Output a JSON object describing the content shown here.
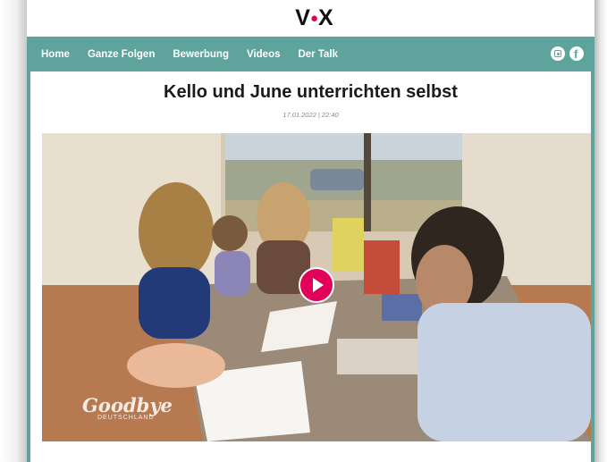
{
  "brand": {
    "logo_left": "V",
    "logo_right": "X",
    "accent": "#e2005a",
    "nav_color": "#5fa49c"
  },
  "nav": {
    "items": [
      {
        "label": "Home"
      },
      {
        "label": "Ganze Folgen"
      },
      {
        "label": "Bewerbung"
      },
      {
        "label": "Videos"
      },
      {
        "label": "Der Talk"
      }
    ],
    "icons": [
      "instagram-icon",
      "facebook-icon"
    ]
  },
  "article": {
    "title": "Kello und June unterrichten selbst",
    "date": "17.01.2022 | 22:40"
  },
  "video": {
    "watermark_title": "Goodbye",
    "watermark_sub": "DEUTSCHLAND",
    "play_icon": "play-icon"
  }
}
